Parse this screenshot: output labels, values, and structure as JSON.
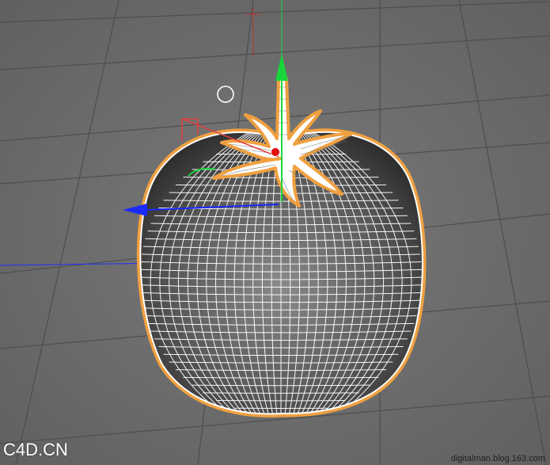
{
  "viewport": {
    "background": "#6d6d6d",
    "grid_color": "#5a5a5a",
    "object_name": "tomato-mesh",
    "selection_outline_color": "#f0a040",
    "wire_color": "#ffffff",
    "axis_colors": {
      "x": "#1a2aff",
      "y": "#19d63a",
      "z": "#e01010"
    }
  },
  "icons": [
    "gizmo-x-arrow-icon",
    "gizmo-y-arrow-icon",
    "pivot-red-point-icon",
    "cursor-circle-icon",
    "world-axis-marker-icon"
  ],
  "watermarks": {
    "left": "C4D.CN",
    "right": "digitalman.blog.163.com"
  }
}
